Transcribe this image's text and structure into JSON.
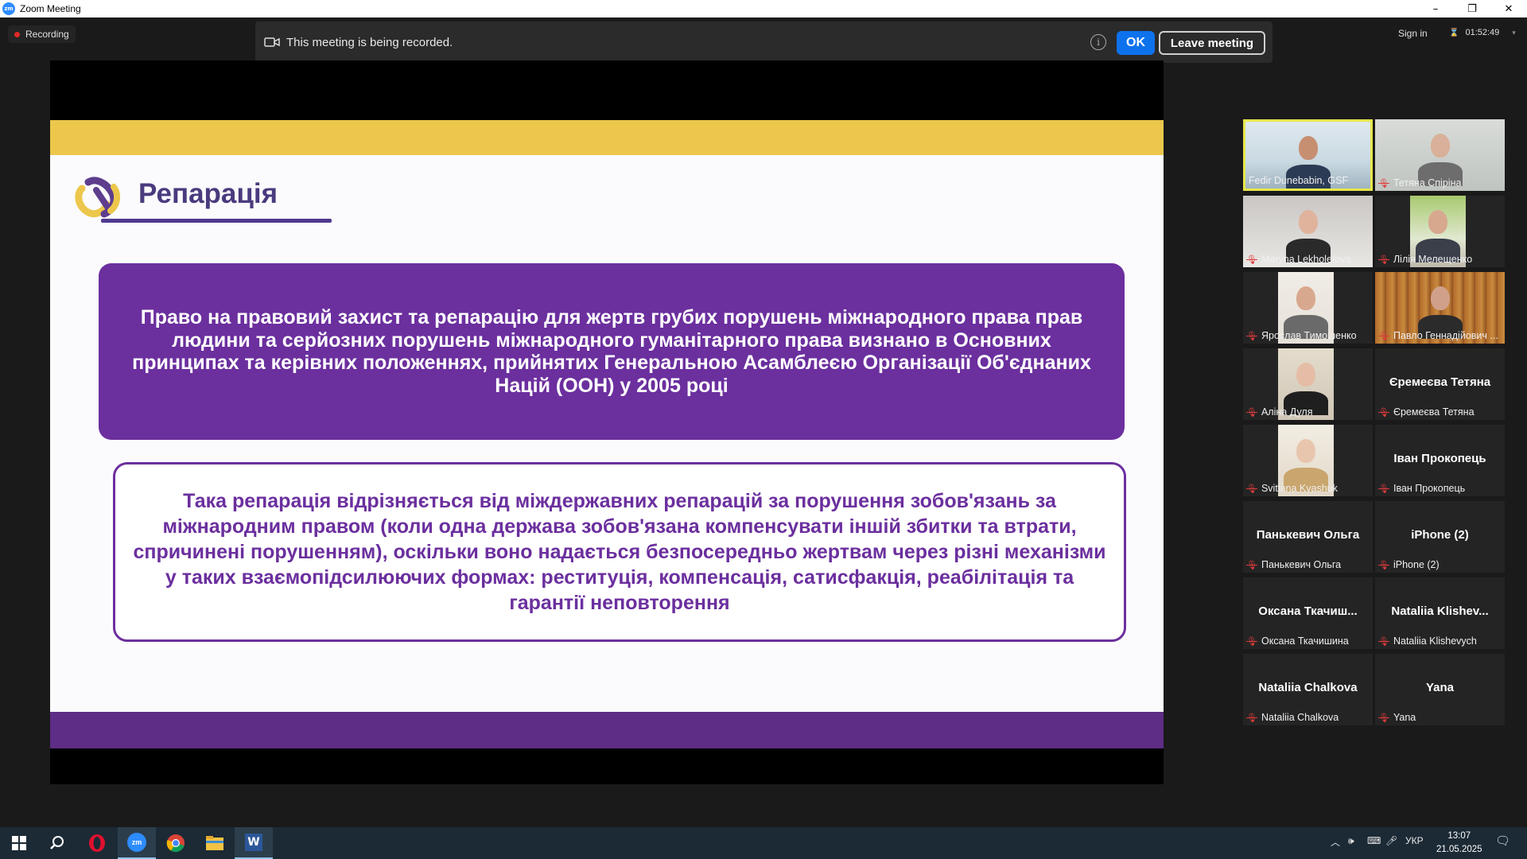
{
  "window": {
    "title": "Zoom Meeting",
    "app_icon": "zm",
    "minimize": "–",
    "restore": "❐",
    "close": "✕"
  },
  "topbar": {
    "recording_label": "Recording",
    "banner_message": "This meeting is being recorded.",
    "ok_label": "OK",
    "leave_label": "Leave meeting",
    "sign_in": "Sign in",
    "timer": "01:52:49"
  },
  "slide": {
    "title": "Репарація",
    "box1_text": "Право на правовий захист та репарацію для жертв грубих порушень міжнародного права прав людини та серйозних порушень міжнародного гуманітарного права визнано в Основних принципах та керівних положеннях, прийнятих Генеральною Асамблеєю Організації Об'єднаних Націй (ООН) у 2005 році",
    "box2_text": "Така репарація відрізняється від міждержавних репарацій за порушення зобов'язань за міжнародним правом (коли одна держава зобов'язана компенсувати іншій збитки та втрати, спричинені порушенням), оскільки воно надається безпосередньо жертвам через різні механізми у таких взаємопідсилюючих формах: реституція, компенсація, сатисфакція, реабілітація та гарантії неповторення",
    "colors": {
      "yellow": "#ecc74c",
      "purple": "#6b2f9e",
      "title": "#4a3a7e"
    }
  },
  "participants": [
    {
      "name": "Fedir Dunebabin, GSF",
      "muted": false,
      "video": true,
      "active": true,
      "big": ""
    },
    {
      "name": "Тетяна Спіріна",
      "muted": true,
      "video": true,
      "active": false,
      "big": ""
    },
    {
      "name": "Maryna Lekholetova",
      "muted": true,
      "video": true,
      "active": false,
      "big": ""
    },
    {
      "name": "Лілія Мелещенко",
      "muted": true,
      "video": true,
      "active": false,
      "big": ""
    },
    {
      "name": "Ярослав Тимошенко",
      "muted": true,
      "video": true,
      "active": false,
      "big": ""
    },
    {
      "name": "Павло Геннадійович ...",
      "muted": true,
      "video": true,
      "active": false,
      "big": ""
    },
    {
      "name": "Аліна Дуля",
      "muted": true,
      "video": true,
      "active": false,
      "big": ""
    },
    {
      "name": "Єремеєва Тетяна",
      "muted": true,
      "video": false,
      "active": false,
      "big": "Єремеєва Тетяна"
    },
    {
      "name": "Svitlana Kvashuk",
      "muted": true,
      "video": true,
      "active": false,
      "big": ""
    },
    {
      "name": "Іван Прокопець",
      "muted": true,
      "video": false,
      "active": false,
      "big": "Іван Прокопець"
    },
    {
      "name": "Панькевич Ольга",
      "muted": true,
      "video": false,
      "active": false,
      "big": "Панькевич Ольга"
    },
    {
      "name": "iPhone (2)",
      "muted": true,
      "video": false,
      "active": false,
      "big": "iPhone (2)"
    },
    {
      "name": "Оксана Ткачишина",
      "muted": true,
      "video": false,
      "active": false,
      "big": "Оксана  Ткачиш..."
    },
    {
      "name": "Nataliia Klishevych",
      "muted": true,
      "video": false,
      "active": false,
      "big": "Nataliia  Klishev..."
    },
    {
      "name": "Nataliia Chalkova",
      "muted": true,
      "video": false,
      "active": false,
      "big": "Nataliia Chalkova"
    },
    {
      "name": "Yana",
      "muted": true,
      "video": false,
      "active": false,
      "big": "Yana"
    }
  ],
  "taskbar": {
    "language": "УКР",
    "time": "13:07",
    "date": "21.05.2025",
    "apps": [
      "start",
      "search",
      "opera",
      "zoom",
      "chrome",
      "file-explorer",
      "word"
    ]
  }
}
